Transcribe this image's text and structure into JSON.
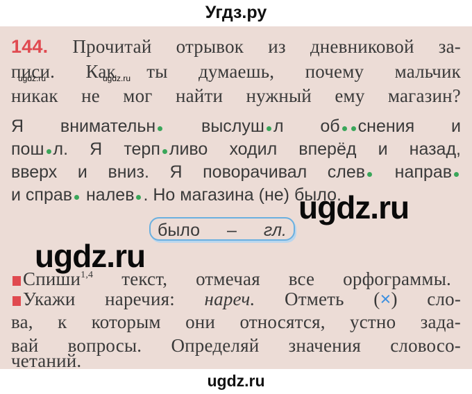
{
  "header": {
    "site_title": "Угдз.ру"
  },
  "exercise": {
    "number": "144.",
    "question_lines": [
      "Прочитай отрывок из дневниковой за-",
      "писи. Как ты думаешь, почему мальчик",
      "никак не мог найти нужный ему магазин?"
    ],
    "text_lines": [
      "Я внимательн• выслуш•л об••снения и",
      "пош•л. Я терп•ливо ходил вперёд и назад,",
      "вверх и вниз. Я поворачивал слев• направ•",
      "и справ• налев•. Но магазина (не) было."
    ],
    "box": {
      "word": "было",
      "dash": "–",
      "label": "гл."
    },
    "task1": {
      "verb": "Спиши",
      "superscript": "1,4",
      "rest": "текст, отмечая все орфограммы."
    },
    "task2": {
      "line1_a": "Укажи наречия:",
      "line1_italic": "нареч.",
      "line1_b": "Отметь (",
      "mark": "×",
      "line1_c": ") сло-",
      "lines": [
        "ва, к которым они относятся, устно зада-",
        "вай вопросы. Определяй значения словосо-",
        "четаний."
      ]
    },
    "gap_marker_color": "#3aa65a",
    "accent_color": "#e04a50"
  },
  "watermarks": {
    "small": "ugdz.ru",
    "large": "ugdz.ru",
    "footer": "ugdz.ru"
  }
}
